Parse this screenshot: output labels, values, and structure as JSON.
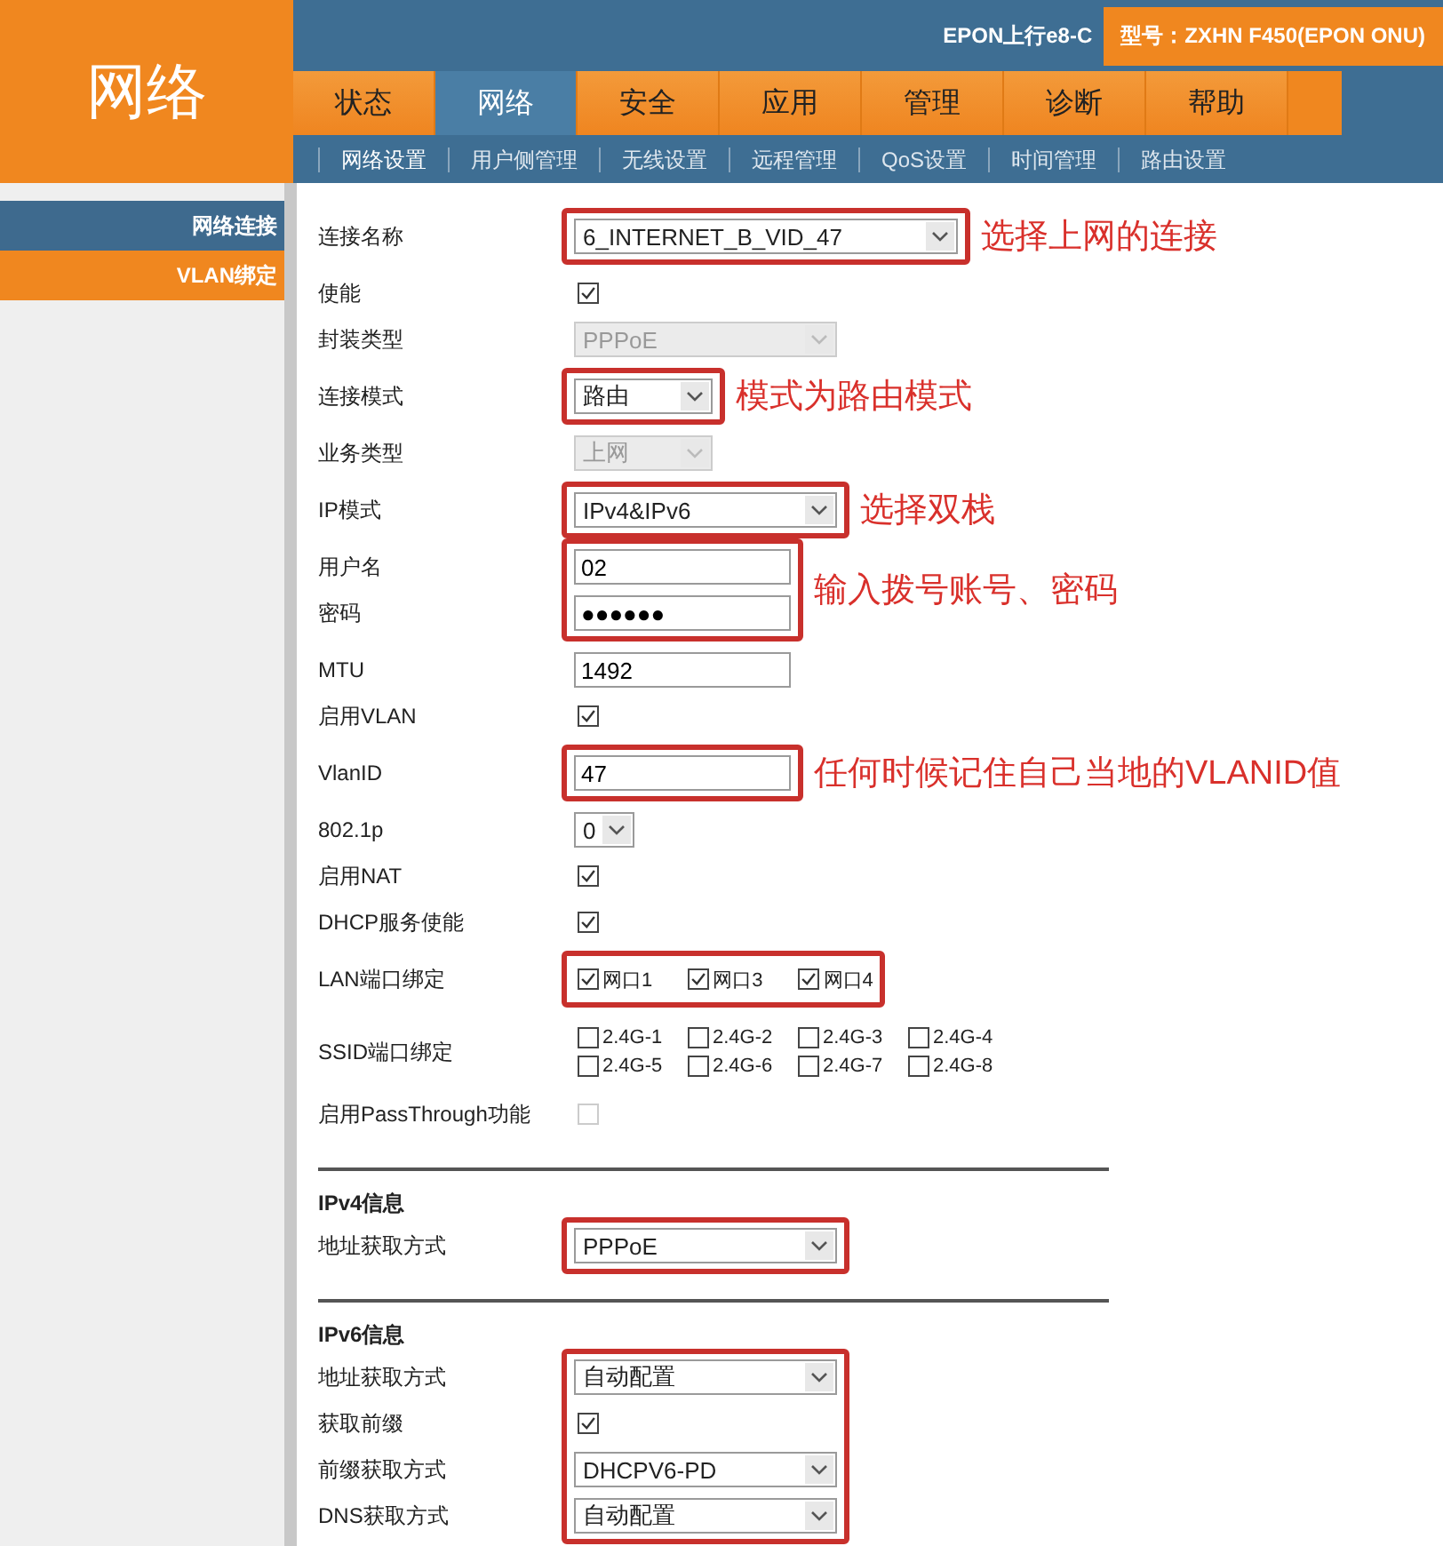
{
  "logo": "网络",
  "header": {
    "upstream": "EPON上行e8-C",
    "model": "型号：ZXHN F450(EPON ONU)"
  },
  "tabs": [
    {
      "label": "状态",
      "selected": false
    },
    {
      "label": "网络",
      "selected": true
    },
    {
      "label": "安全",
      "selected": false
    },
    {
      "label": "应用",
      "selected": false
    },
    {
      "label": "管理",
      "selected": false
    },
    {
      "label": "诊断",
      "selected": false
    },
    {
      "label": "帮助",
      "selected": false
    }
  ],
  "subtabs": [
    {
      "label": "网络设置",
      "selected": true
    },
    {
      "label": "用户侧管理",
      "selected": false
    },
    {
      "label": "无线设置",
      "selected": false
    },
    {
      "label": "远程管理",
      "selected": false
    },
    {
      "label": "QoS设置",
      "selected": false
    },
    {
      "label": "时间管理",
      "selected": false
    },
    {
      "label": "路由设置",
      "selected": false
    }
  ],
  "sidebar": [
    {
      "label": "网络连接",
      "selected": true
    },
    {
      "label": "VLAN绑定",
      "selected": false
    }
  ],
  "sections": [
    {
      "groups": [
        {
          "highlight": true,
          "note": "选择上网的连接",
          "rows": [
            {
              "label": "连接名称",
              "kind": "select",
              "value": "6_INTERNET_B_VID_47",
              "disabled": false
            }
          ]
        },
        {
          "highlight": false,
          "rows": [
            {
              "label": "使能",
              "kind": "checkbox",
              "checked": true,
              "disabled": false
            },
            {
              "label": "封装类型",
              "kind": "select",
              "value": "PPPoE",
              "disabled": true
            }
          ]
        },
        {
          "highlight": true,
          "note": "模式为路由模式",
          "rows": [
            {
              "label": "连接模式",
              "kind": "select",
              "value": "路由",
              "disabled": false
            }
          ]
        },
        {
          "highlight": false,
          "rows": [
            {
              "label": "业务类型",
              "kind": "select",
              "value": "上网",
              "disabled": true
            }
          ]
        },
        {
          "highlight": true,
          "note": "选择双栈",
          "rows": [
            {
              "label": "IP模式",
              "kind": "select",
              "value": "IPv4&IPv6",
              "disabled": false
            }
          ]
        },
        {
          "highlight": true,
          "note": "输入拨号账号、密码",
          "rows": [
            {
              "label": "用户名",
              "kind": "text",
              "value": "02"
            },
            {
              "label": "密码",
              "kind": "text",
              "value": "●●●●●●"
            }
          ]
        },
        {
          "highlight": false,
          "rows": [
            {
              "label": "MTU",
              "kind": "text",
              "value": "1492"
            },
            {
              "label": "启用VLAN",
              "kind": "checkbox",
              "checked": true,
              "disabled": false
            }
          ]
        },
        {
          "highlight": true,
          "note": "任何时候记住自己当地的VLANID值",
          "rows": [
            {
              "label": "VlanID",
              "kind": "text",
              "value": "47"
            }
          ]
        },
        {
          "highlight": false,
          "rows": [
            {
              "label": "802.1p",
              "kind": "select",
              "value": "0",
              "disabled": false
            },
            {
              "label": "启用NAT",
              "kind": "checkbox",
              "checked": true,
              "disabled": false
            },
            {
              "label": "DHCP服务使能",
              "kind": "checkbox",
              "checked": true,
              "disabled": false
            }
          ]
        },
        {
          "highlight": true,
          "rows": [
            {
              "label": "LAN端口绑定",
              "kind": "ports",
              "items": [
                {
                  "label": "网口1",
                  "checked": true
                },
                {
                  "label": "网口3",
                  "checked": true
                },
                {
                  "label": "网口4",
                  "checked": true
                }
              ]
            }
          ]
        },
        {
          "highlight": false,
          "rows": [
            {
              "label": "SSID端口绑定",
              "kind": "ports",
              "items": [
                {
                  "label": "2.4G-1",
                  "checked": false
                },
                {
                  "label": "2.4G-2",
                  "checked": false
                },
                {
                  "label": "2.4G-3",
                  "checked": false
                },
                {
                  "label": "2.4G-4",
                  "checked": false
                },
                {
                  "label": "2.4G-5",
                  "checked": false
                },
                {
                  "label": "2.4G-6",
                  "checked": false
                },
                {
                  "label": "2.4G-7",
                  "checked": false
                },
                {
                  "label": "2.4G-8",
                  "checked": false
                }
              ]
            },
            {
              "label": "启用PassThrough功能",
              "kind": "checkbox",
              "checked": false,
              "disabled": true
            }
          ]
        }
      ]
    },
    {
      "title": "IPv4信息",
      "groups": [
        {
          "highlight": true,
          "rows": [
            {
              "label": "地址获取方式",
              "kind": "select",
              "value": "PPPoE",
              "disabled": false
            }
          ]
        }
      ]
    },
    {
      "title": "IPv6信息",
      "groups": [
        {
          "highlight": true,
          "rows": [
            {
              "label": "地址获取方式",
              "kind": "select",
              "value": "自动配置",
              "disabled": false
            },
            {
              "label": "获取前缀",
              "kind": "checkbox",
              "checked": true,
              "disabled": false
            },
            {
              "label": "前缀获取方式",
              "kind": "select",
              "value": "DHCPV6-PD",
              "disabled": false
            },
            {
              "label": "DNS获取方式",
              "kind": "select",
              "value": "自动配置",
              "disabled": false
            }
          ]
        }
      ]
    }
  ]
}
